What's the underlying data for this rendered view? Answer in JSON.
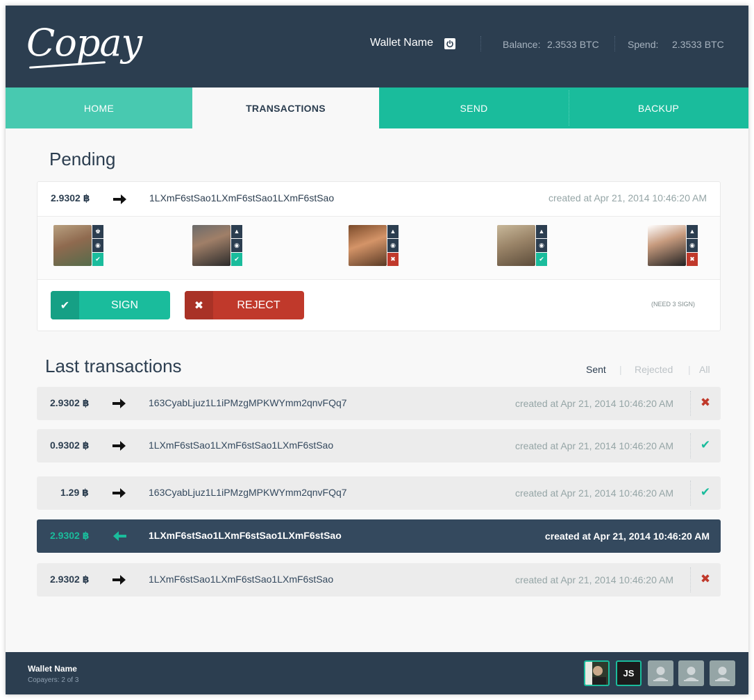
{
  "header": {
    "logo": "Copay",
    "wallet_name": "Wallet Name",
    "balance_label": "Balance:",
    "balance_value": "2.3533 BTC",
    "spend_label": "Spend:",
    "spend_value": "2.3533 BTC"
  },
  "nav": {
    "tabs": [
      {
        "label": "HOME"
      },
      {
        "label": "TRANSACTIONS"
      },
      {
        "label": "SEND"
      },
      {
        "label": "BACKUP"
      }
    ],
    "active": "TRANSACTIONS"
  },
  "pending": {
    "title": "Pending",
    "amount": "2.9302",
    "address": "1LXmF6stSao1LXmF6stSao1LXmF6stSao",
    "created": "created at Apr 21, 2014 10:46:20 AM",
    "signers": [
      {
        "status": "signed",
        "badge_top": "crown-icon"
      },
      {
        "status": "signed",
        "badge_top": "home-icon"
      },
      {
        "status": "rejected",
        "badge_top": "home-icon"
      },
      {
        "status": "signed",
        "badge_top": "home-icon"
      },
      {
        "status": "rejected",
        "badge_top": "home-icon"
      }
    ],
    "sign_label": "SIGN",
    "reject_label": "REJECT",
    "need_sign": "(NEED 3 SIGN)"
  },
  "last": {
    "title": "Last transactions",
    "filters": {
      "sent": "Sent",
      "rejected": "Rejected",
      "all": "All",
      "active": "Sent"
    },
    "rows": [
      {
        "amount": "2.9302",
        "address": "163CyabLjuz1L1iPMzgMPKWYmm2qnvFQq7",
        "created": "created at Apr 21, 2014 10:46:20 AM",
        "status": "rejected",
        "direction": "out"
      },
      {
        "amount": "0.9302",
        "address": "1LXmF6stSao1LXmF6stSao1LXmF6stSao",
        "created": "created at Apr 21, 2014 10:46:20 AM",
        "status": "confirmed",
        "direction": "out"
      },
      {
        "amount": "1.29",
        "address": "163CyabLjuz1L1iPMzgMPKWYmm2qnvFQq7",
        "created": "created at Apr 21, 2014 10:46:20 AM",
        "status": "confirmed",
        "direction": "out"
      },
      {
        "amount": "2.9302",
        "address": "1LXmF6stSao1LXmF6stSao1LXmF6stSao",
        "created": "created at Apr 21, 2014 10:46:20 AM",
        "status": "none",
        "direction": "in"
      },
      {
        "amount": "2.9302",
        "address": "1LXmF6stSao1LXmF6stSao1LXmF6stSao",
        "created": "created at Apr 21, 2014 10:46:20 AM",
        "status": "rejected",
        "direction": "out"
      }
    ]
  },
  "footer": {
    "wallet_name": "Wallet Name",
    "copayers": "Copayers: 2 of 3",
    "avatars": [
      {
        "type": "photo"
      },
      {
        "type": "initials",
        "text": "JS"
      },
      {
        "type": "empty"
      },
      {
        "type": "empty"
      },
      {
        "type": "empty"
      }
    ]
  },
  "colors": {
    "header_bg": "#2c3e50",
    "accent": "#1abc9c",
    "danger": "#c0392b",
    "row_bg": "#ececec",
    "row_active_bg": "#34495e"
  }
}
